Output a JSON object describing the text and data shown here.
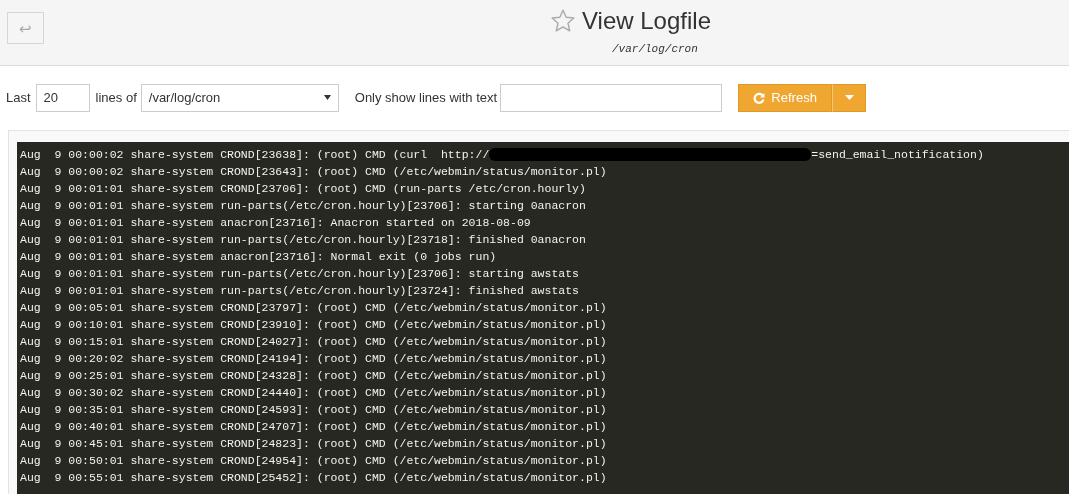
{
  "header": {
    "back_button": "↩",
    "title": "View Logfile",
    "subtitle": "/var/log/cron",
    "favorite": false
  },
  "controls": {
    "last_label": "Last",
    "lines_value": "20",
    "lines_of_label": "lines of",
    "file_value": "/var/log/cron",
    "filter_label": "Only show lines with text",
    "refresh_button": "Refresh"
  },
  "log_lines": [
    {
      "text": "Aug  9 00:00:02 share-system CROND[23638]: (root) CMD (curl  http://",
      "redacted": true,
      "after": "=send_email_notification)"
    },
    {
      "text": "Aug  9 00:00:02 share-system CROND[23643]: (root) CMD (/etc/webmin/status/monitor.pl)",
      "redacted": false
    },
    {
      "text": "Aug  9 00:01:01 share-system CROND[23706]: (root) CMD (run-parts /etc/cron.hourly)",
      "redacted": false
    },
    {
      "text": "Aug  9 00:01:01 share-system run-parts(/etc/cron.hourly)[23706]: starting 0anacron",
      "redacted": false
    },
    {
      "text": "Aug  9 00:01:01 share-system anacron[23716]: Anacron started on 2018-08-09",
      "redacted": false
    },
    {
      "text": "Aug  9 00:01:01 share-system run-parts(/etc/cron.hourly)[23718]: finished 0anacron",
      "redacted": false
    },
    {
      "text": "Aug  9 00:01:01 share-system anacron[23716]: Normal exit (0 jobs run)",
      "redacted": false
    },
    {
      "text": "Aug  9 00:01:01 share-system run-parts(/etc/cron.hourly)[23706]: starting awstats",
      "redacted": false
    },
    {
      "text": "Aug  9 00:01:01 share-system run-parts(/etc/cron.hourly)[23724]: finished awstats",
      "redacted": false
    },
    {
      "text": "Aug  9 00:05:01 share-system CROND[23797]: (root) CMD (/etc/webmin/status/monitor.pl)",
      "redacted": false
    },
    {
      "text": "Aug  9 00:10:01 share-system CROND[23910]: (root) CMD (/etc/webmin/status/monitor.pl)",
      "redacted": false
    },
    {
      "text": "Aug  9 00:15:01 share-system CROND[24027]: (root) CMD (/etc/webmin/status/monitor.pl)",
      "redacted": false
    },
    {
      "text": "Aug  9 00:20:02 share-system CROND[24194]: (root) CMD (/etc/webmin/status/monitor.pl)",
      "redacted": false
    },
    {
      "text": "Aug  9 00:25:01 share-system CROND[24328]: (root) CMD (/etc/webmin/status/monitor.pl)",
      "redacted": false
    },
    {
      "text": "Aug  9 00:30:02 share-system CROND[24440]: (root) CMD (/etc/webmin/status/monitor.pl)",
      "redacted": false
    },
    {
      "text": "Aug  9 00:35:01 share-system CROND[24593]: (root) CMD (/etc/webmin/status/monitor.pl)",
      "redacted": false
    },
    {
      "text": "Aug  9 00:40:01 share-system CROND[24707]: (root) CMD (/etc/webmin/status/monitor.pl)",
      "redacted": false
    },
    {
      "text": "Aug  9 00:45:01 share-system CROND[24823]: (root) CMD (/etc/webmin/status/monitor.pl)",
      "redacted": false
    },
    {
      "text": "Aug  9 00:50:01 share-system CROND[24954]: (root) CMD (/etc/webmin/status/monitor.pl)",
      "redacted": false
    },
    {
      "text": "Aug  9 00:55:01 share-system CROND[25452]: (root) CMD (/etc/webmin/status/monitor.pl)",
      "redacted": false
    }
  ]
}
